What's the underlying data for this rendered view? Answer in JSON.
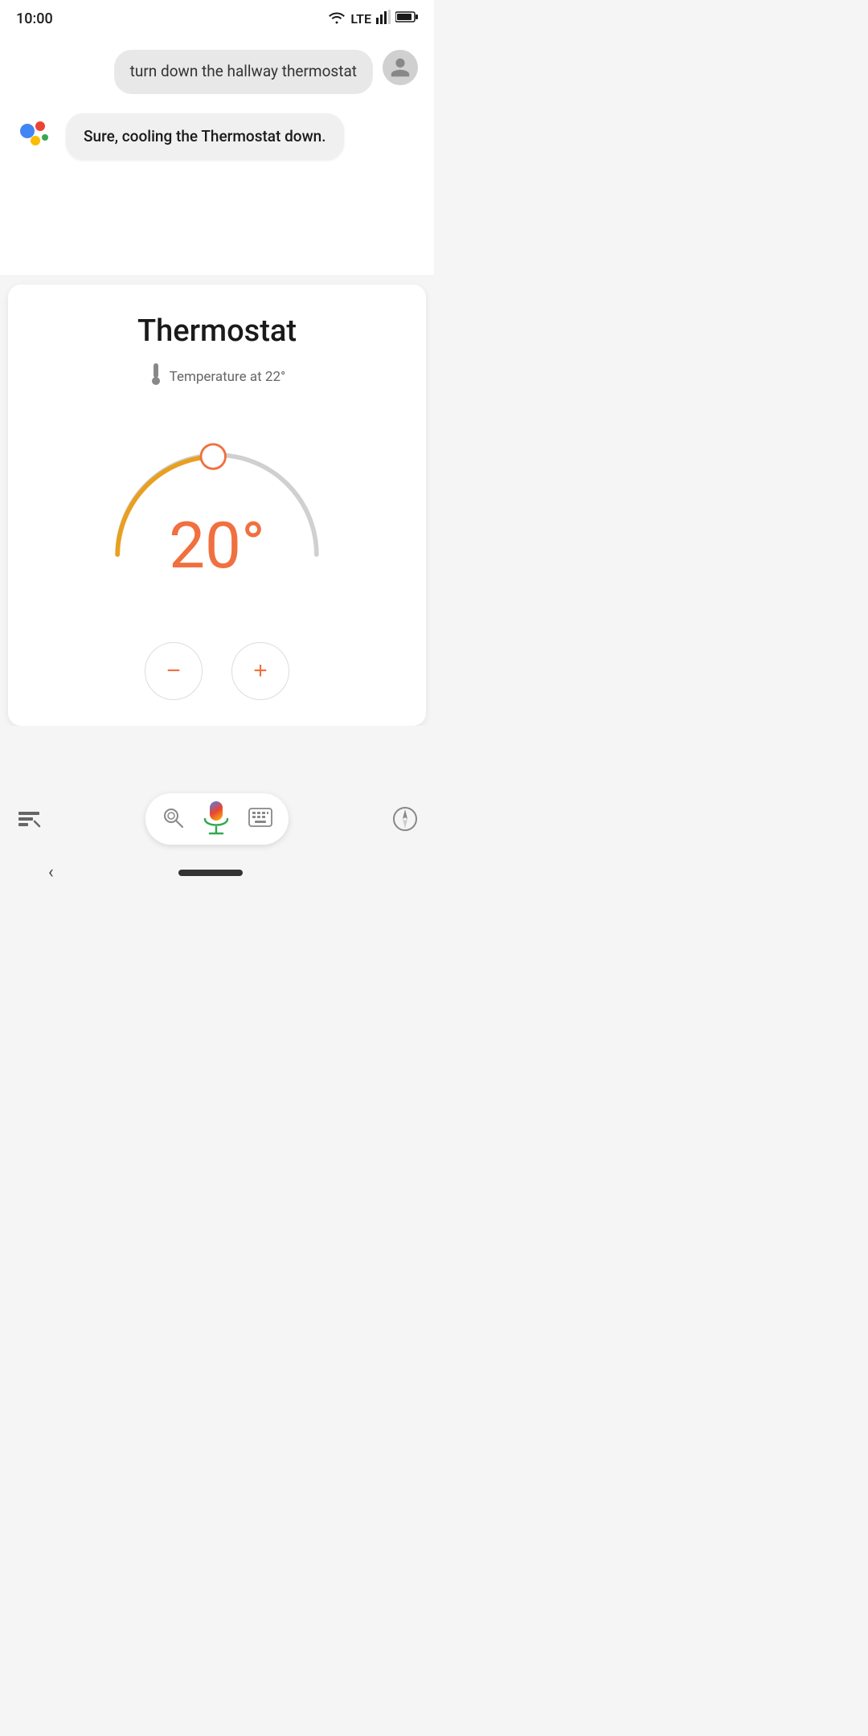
{
  "statusBar": {
    "time": "10:00",
    "wifiLabel": "wifi",
    "lteLabel": "LTE",
    "signalLabel": "signal",
    "batteryLabel": "battery"
  },
  "chat": {
    "userMessage": "turn down the hallway thermostat",
    "assistantMessage": "Sure, cooling the Thermostat down."
  },
  "thermostat": {
    "title": "Thermostat",
    "tempLabel": "Temperature at 22°",
    "currentTemp": "20°",
    "dialMin": 10,
    "dialMax": 30,
    "currentValue": 20,
    "decreaseLabel": "−",
    "increaseLabel": "+"
  },
  "colors": {
    "orange": "#f07040",
    "dialActive": "#e8a020",
    "dialInactive": "#cccccc",
    "dialHandle": "#f07040"
  }
}
